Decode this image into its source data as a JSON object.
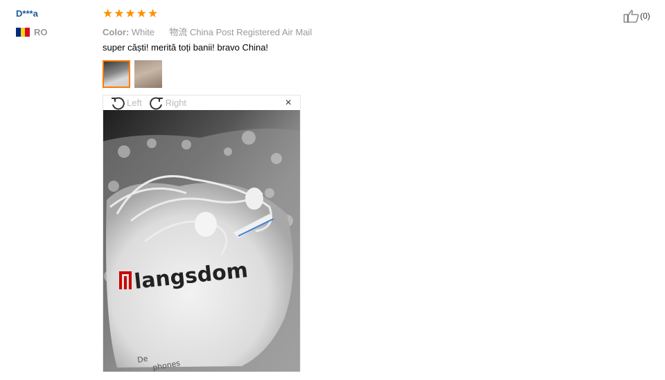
{
  "reviewer": {
    "name": "D***a",
    "country_code": "RO"
  },
  "rating": {
    "stars": 5,
    "max": 5,
    "color": "#ff8f00"
  },
  "meta": {
    "color_label": "Color:",
    "color_value": "White",
    "shipping_icon_text": "物流",
    "shipping_value": "China Post Registered Air Mail"
  },
  "review": {
    "text": "super căști! merită toți banii! bravo China!"
  },
  "thumbnails": [
    {
      "state": "selected"
    },
    {
      "state": "normal"
    }
  ],
  "viewer": {
    "rotate_left": "Left",
    "rotate_right": "Right",
    "close_symbol": "×"
  },
  "photo": {
    "brand_text": "langsdom",
    "bottom_text_1": "De",
    "bottom_text_2": "phones"
  },
  "helpful": {
    "count": "(0)"
  },
  "colors": {
    "name": "#1c5a9c",
    "accent": "#ff7a00",
    "muted": "#999999"
  }
}
